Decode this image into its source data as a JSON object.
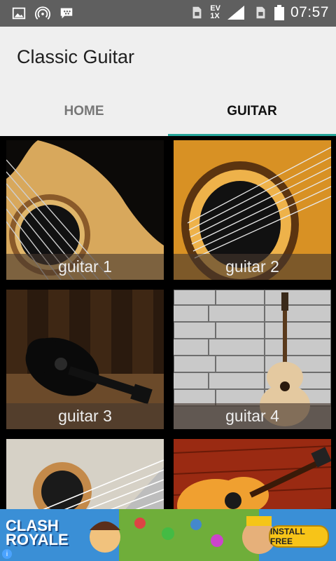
{
  "status": {
    "time": "07:57",
    "net_up": "EV",
    "net_down": "1X",
    "net_label": "EV"
  },
  "app": {
    "title": "Classic Guitar"
  },
  "tabs": [
    {
      "label": "HOME",
      "active": false
    },
    {
      "label": "GUITAR",
      "active": true
    }
  ],
  "tiles": [
    {
      "caption": "guitar 1"
    },
    {
      "caption": "guitar 2"
    },
    {
      "caption": "guitar 3"
    },
    {
      "caption": "guitar 4"
    },
    {
      "caption": ""
    },
    {
      "caption": ""
    }
  ],
  "ad": {
    "brand_line1": "CLASH",
    "brand_line2": "ROYALE",
    "cta": "INSTALL FREE",
    "info": "i"
  }
}
